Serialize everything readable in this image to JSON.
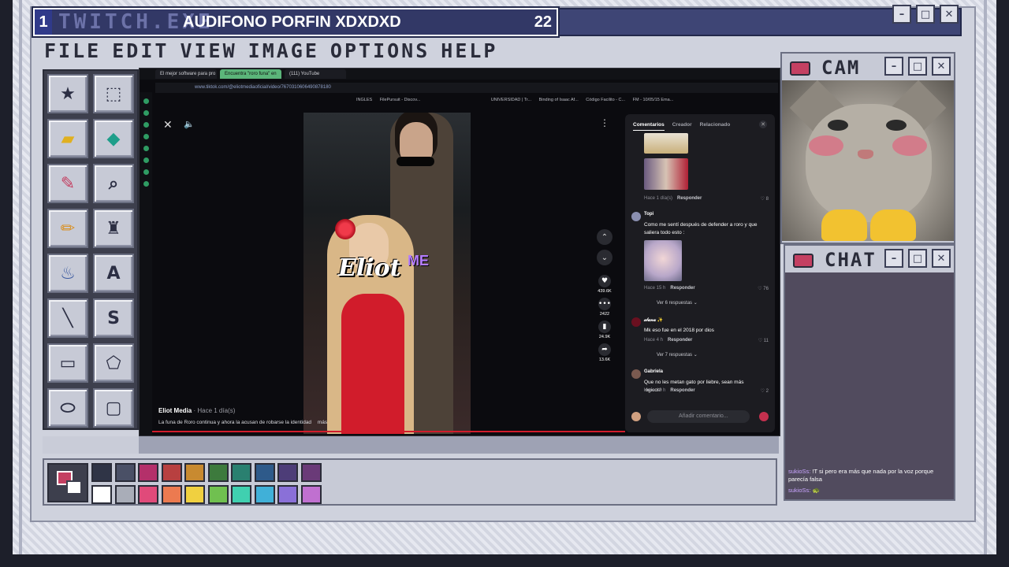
{
  "stream": {
    "channel_number": "1",
    "channel_ghost": "TWITCH.EXE",
    "title": "AUDIFONO PORFIN XDXDXD",
    "viewer_count": "22"
  },
  "window_controls": {
    "minimize": "–",
    "maximize": "□",
    "close": "✕"
  },
  "menu": [
    "FILE",
    "EDIT",
    "VIEW",
    "IMAGE",
    "OPTIONS",
    "HELP"
  ],
  "tools": [
    {
      "name": "star-tool-icon",
      "glyph": "★"
    },
    {
      "name": "select-tool-icon",
      "glyph": "⬚"
    },
    {
      "name": "eraser-tool-icon",
      "glyph": "▰"
    },
    {
      "name": "fill-tool-icon",
      "glyph": "◆"
    },
    {
      "name": "eyedropper-tool-icon",
      "glyph": "✎"
    },
    {
      "name": "magnifier-tool-icon",
      "glyph": "⌕"
    },
    {
      "name": "pencil-tool-icon",
      "glyph": "✏"
    },
    {
      "name": "brush-tool-icon",
      "glyph": "♜"
    },
    {
      "name": "spray-tool-icon",
      "glyph": "♨"
    },
    {
      "name": "text-tool-icon",
      "glyph": "A"
    },
    {
      "name": "line-tool-icon",
      "glyph": "╲"
    },
    {
      "name": "curve-tool-icon",
      "glyph": "S"
    },
    {
      "name": "rectangle-tool-icon",
      "glyph": "▭"
    },
    {
      "name": "polygon-tool-icon",
      "glyph": "⬠"
    },
    {
      "name": "ellipse-tool-icon",
      "glyph": "⬭"
    },
    {
      "name": "rounded-rect-tool-icon",
      "glyph": "▢"
    }
  ],
  "browser": {
    "tabs": [
      {
        "label": "El mejor software para pro",
        "active": false
      },
      {
        "label": "Encuentra \"roro funa\" en",
        "active": true
      },
      {
        "label": "(111) YouTube",
        "active": false
      }
    ],
    "url": "www.tiktok.com/@eliotmediaoficial/video/7670310606490878180",
    "bookmarks": [
      "INGLES",
      "FilePursuit - Discov...",
      "UNIVERSIDAD | Tr...",
      "Binding of Isaac Af...",
      "Código Facilito - C...",
      "FM - 10/05/15 Ema..."
    ]
  },
  "video": {
    "logo_text": "Eliot",
    "logo_sub": "ME",
    "author": "Eliot Media",
    "posted": "· Hace 1 día(s)",
    "description": "La funa de Roro continua y ahora la acusan de robarse la identidad",
    "more": "más",
    "actions": [
      {
        "name": "like-icon",
        "glyph": "♥",
        "count": "439.6K"
      },
      {
        "name": "comment-icon",
        "glyph": "•••",
        "count": "2422"
      },
      {
        "name": "bookmark-icon",
        "glyph": "▮",
        "count": "24.9K"
      },
      {
        "name": "share-icon",
        "glyph": "➦",
        "count": "13.6K"
      }
    ]
  },
  "comments": {
    "tabs": [
      "Comentarios",
      "Creador",
      "Relacionado"
    ],
    "items": [
      {
        "user": "",
        "text": "",
        "time": "Hace 1 día(s)",
        "reply": "Responder",
        "likes": "♡ 8"
      },
      {
        "user": "Topi",
        "text": "Como me sentí después de defender a roro y que saliera todo esto :",
        "time": "Hace 15 h",
        "reply": "Responder",
        "likes": "♡ 76",
        "more_replies": "Ver 6 respuestas ⌄"
      },
      {
        "user": "𝓍𝓁𝓊𝓃𝒶 ✨",
        "text": "Mk eso fue en el 2018 por dios",
        "time": "Hace 4 h",
        "reply": "Responder",
        "likes": "♡ 11",
        "more_replies": "Ver 7 respuestas ⌄"
      },
      {
        "user": "Gabriela",
        "text": "Que no les metan gato por liebre, sean más lógicos!",
        "time": "Hace 10 h",
        "reply": "Responder",
        "likes": "♡ 2"
      }
    ],
    "input_placeholder": "Añadir comentario..."
  },
  "palette": {
    "primary": "#c44062",
    "secondary": "#ffffff",
    "row1": [
      "#2f3446",
      "#4a5066",
      "#b4306a",
      "#b84040",
      "#c88a30",
      "#3d7a3d",
      "#2a8070",
      "#2e5a8a",
      "#4d3d78",
      "#6a3a78"
    ],
    "row2": [
      "#ffffff",
      "#a9adb8",
      "#e04a7a",
      "#ec7a50",
      "#f0d040",
      "#70c050",
      "#40d0b0",
      "#40b0d8",
      "#8a70d8",
      "#c070d0"
    ]
  },
  "cam": {
    "title": "CAM"
  },
  "chat": {
    "title": "CHAT",
    "messages": [
      {
        "user": "sukioSs:",
        "text": " !T si pero era más que nada por la voz porque parecía falsa"
      },
      {
        "user": "sukioSs:",
        "text": " 🐢"
      }
    ]
  }
}
